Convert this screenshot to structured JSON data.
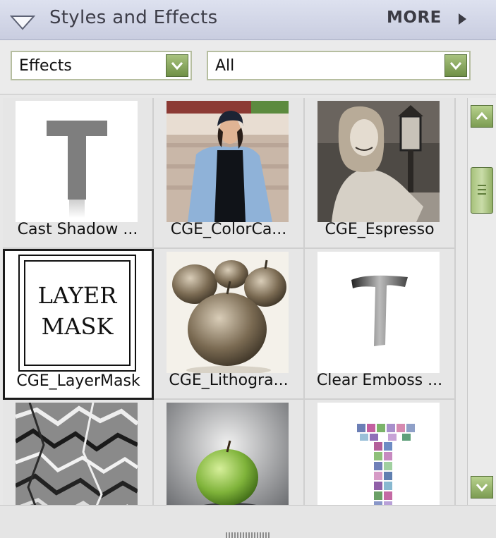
{
  "panel": {
    "title": "Styles and Effects",
    "more_label": "MORE",
    "collapse_icon": "triangle-down-icon",
    "more_icon": "triangle-right-icon"
  },
  "filters": {
    "type_value": "Effects",
    "category_value": "All"
  },
  "effects": [
    {
      "label": "Cast Shadow ...",
      "thumbnail": "gray-T-with-shadow"
    },
    {
      "label": "CGE_ColorCa...",
      "thumbnail": "woman-denim-jacket-photo"
    },
    {
      "label": "CGE_Espresso",
      "thumbnail": "woman-with-lantern-bw-photo"
    },
    {
      "label": "CGE_LayerMask",
      "thumbnail": "layer-mask-text",
      "thumb_text": [
        "LAYER",
        "MASK"
      ],
      "selected": true
    },
    {
      "label": "CGE_Lithogra...",
      "thumbnail": "sepia-apples-photo"
    },
    {
      "label": "Clear Emboss ...",
      "thumbnail": "embossed-T"
    },
    {
      "label": "",
      "thumbnail": "crumpled-texture"
    },
    {
      "label": "",
      "thumbnail": "green-apple-photo"
    },
    {
      "label": "",
      "thumbnail": "mosaic-T"
    }
  ],
  "colors": {
    "header_bg": "#c9cde0",
    "accent_green": "#7c9c52",
    "selection_border": "#1b1b1b"
  }
}
